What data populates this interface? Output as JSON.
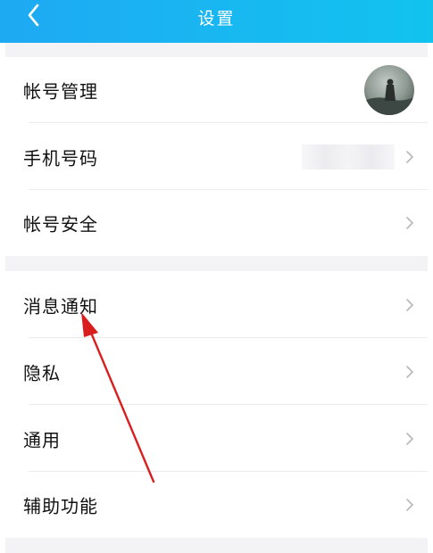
{
  "header": {
    "title": "设置",
    "back_icon": "chevron-left-icon",
    "background": "#1aaff2"
  },
  "settings": {
    "account_management": "帐号管理",
    "phone_number": "手机号码",
    "account_security": "帐号安全",
    "message_notification": "消息通知",
    "privacy": "隐私",
    "general": "通用",
    "accessibility": "辅助功能"
  },
  "icons": {
    "row_arrow": "chevron-right-icon",
    "avatar": "user-avatar"
  },
  "annotation": {
    "type": "arrow",
    "color": "#d91e1e",
    "points_to": "消息通知"
  }
}
